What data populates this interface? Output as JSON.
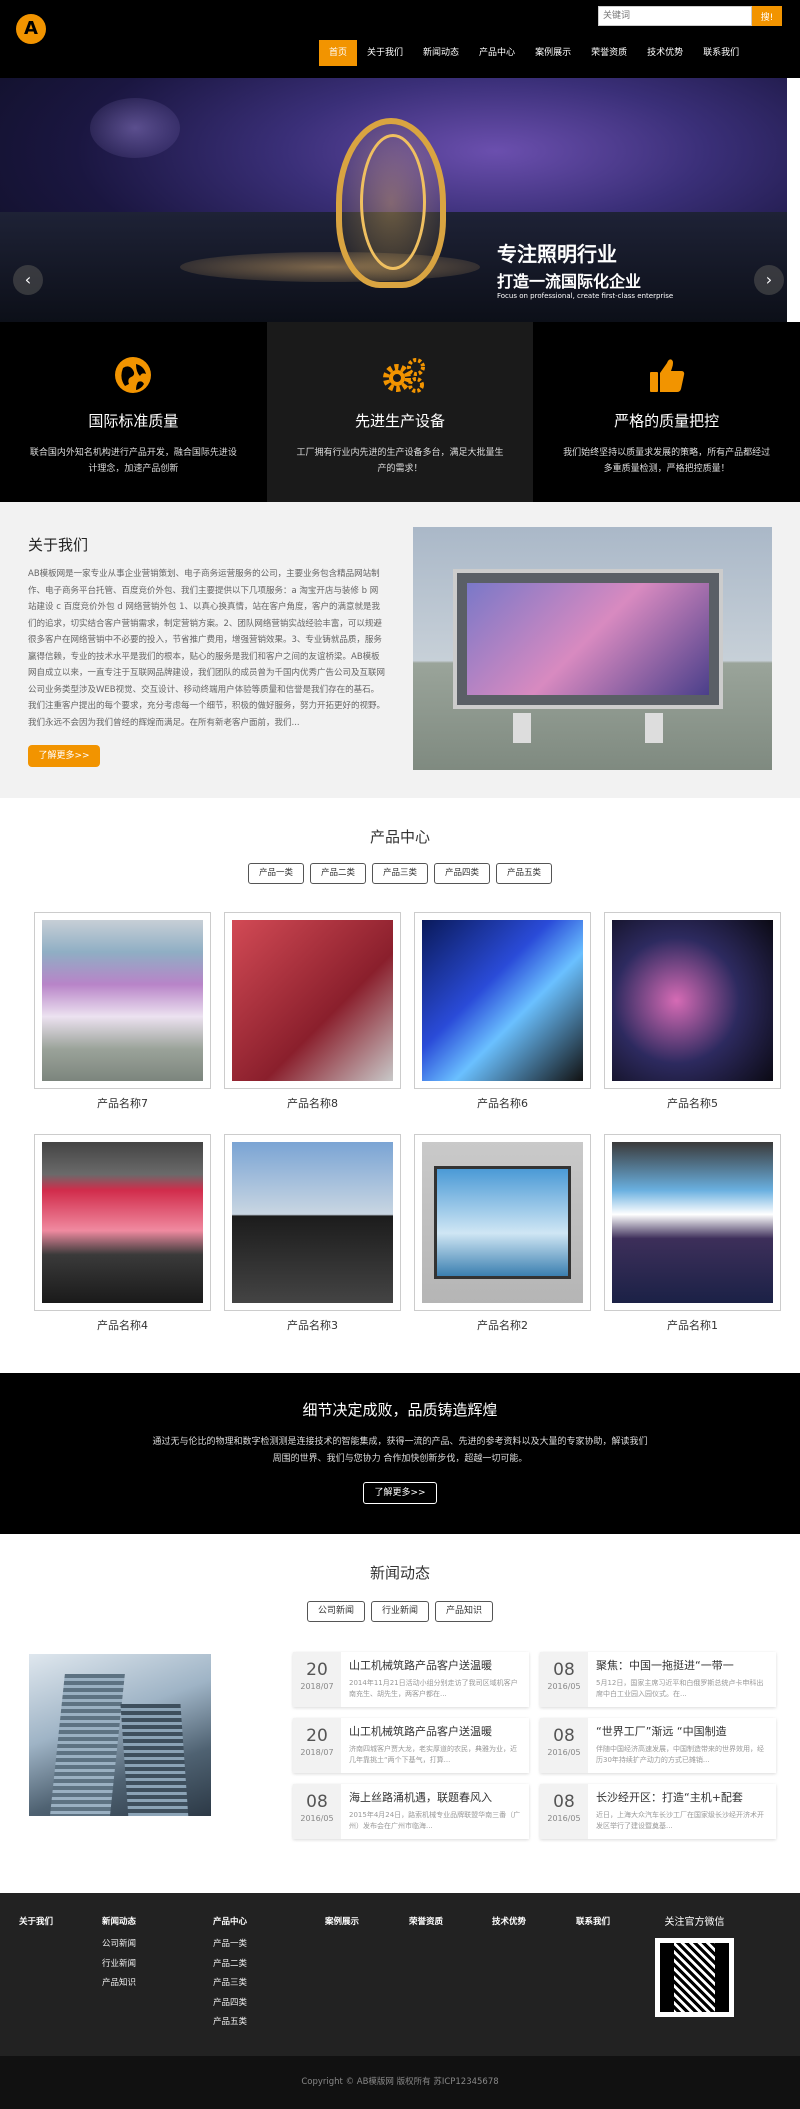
{
  "header": {
    "logo_text": "A",
    "search_placeholder": "关键词",
    "search_button": "搜!",
    "nav": [
      "首页",
      "关于我们",
      "新闻动态",
      "产品中心",
      "案例展示",
      "荣誉资质",
      "技术优势",
      "联系我们"
    ],
    "active_nav": "首页"
  },
  "banner": {
    "slogan_main": "专注照明行业",
    "slogan_sub": "打造一流国际化企业",
    "slogan_en": "Focus on professional, create first-class enterprise",
    "prev_icon": "chevron-left-icon",
    "next_icon": "chevron-right-icon"
  },
  "features": [
    {
      "icon": "globe-icon",
      "title": "国际标准质量",
      "desc": "联合国内外知名机构进行产品开发，融合国际先进设计理念，加速产品创新"
    },
    {
      "icon": "gears-icon",
      "title": "先进生产设备",
      "desc": "工厂拥有行业内先进的生产设备多台，满足大批量生产的需求！"
    },
    {
      "icon": "thumbs-up-icon",
      "title": "严格的质量把控",
      "desc": "我们始终坚持以质量求发展的策略，所有产品都经过多重质量检测，严格把控质量！"
    }
  ],
  "about": {
    "title": "关于我们",
    "text": "AB模板网是一家专业从事企业营销策划、电子商务运营服务的公司，主要业务包含精品网站制作、电子商务平台托管、百度竞价外包、我们主要提供以下几项服务：a 淘宝开店与装修 b 网站建设 c 百度竞价外包 d 网络营销外包 1、以真心换真情，站在客户角度，客户的满意就是我们的追求，切实结合客户营销需求，制定营销方案。2、团队网络营销实战经验丰富，可以规避很多客户在网络营销中不必要的投入，节省推广费用，增强营销效果。3、专业铸就品质，服务赢得信赖，专业的技术水平是我们的根本，贴心的服务是我们和客户之间的友谊桥梁。AB模板网自成立以来，一直专注于互联网品牌建设，我们团队的成员曾为千国内优秀广告公司及互联网公司业务类型涉及WEB视觉、交互设计、移动终端用户体验等质量和信誉是我们存在的基石。我们注重客户提出的每个要求，充分考虑每一个细节，积极的做好服务，努力开拓更好的视野。我们永远不会因为我们曾经的辉煌而满足。在所有新老客户面前，我们...",
    "more_button": "了解更多>>"
  },
  "products": {
    "title": "产品中心",
    "tabs": [
      "产品一类",
      "产品二类",
      "产品三类",
      "产品四类",
      "产品五类"
    ],
    "items": [
      {
        "name": "产品名称7",
        "img": "img7"
      },
      {
        "name": "产品名称8",
        "img": "img2"
      },
      {
        "name": "产品名称6",
        "img": "img3"
      },
      {
        "name": "产品名称5",
        "img": "img4"
      },
      {
        "name": "产品名称4",
        "img": "img5"
      },
      {
        "name": "产品名称3",
        "img": "img6"
      },
      {
        "name": "产品名称2",
        "img": "img1"
      },
      {
        "name": "产品名称1",
        "img": "img8"
      }
    ]
  },
  "detail": {
    "title": "细节决定成败，品质铸造辉煌",
    "text": "通过无与伦比的物理和数字检测测是连接技术的智能集成，获得一流的产品、先进的参考资料以及大量的专家协助，解读我们周围的世界、我们与您协力 合作加快创新步伐，超越一切可能。",
    "button": "了解更多>>"
  },
  "news": {
    "title": "新闻动态",
    "tabs": [
      "公司新闻",
      "行业新闻",
      "产品知识"
    ],
    "items": [
      {
        "day": "20",
        "ym": "2018/07",
        "title": "山工机械筑路产品客户送温暖",
        "summary": "2014年11月21日活动小组分别走访了我司区域机客户南充生、胡先生，两客户都在..."
      },
      {
        "day": "08",
        "ym": "2016/05",
        "title": "聚焦：中国一拖挺进“一带一",
        "summary": "5月12日，国家主席习近平和白俄罗斯总统卢卡申科出席中白工业园入园仪式。在..."
      },
      {
        "day": "20",
        "ym": "2018/07",
        "title": "山工机械筑路产品客户送温暖",
        "summary": "济南四城客户贾大龙，老实厚道的农民，典雅为业，近几年靠挑土“两个下基气，打算..."
      },
      {
        "day": "08",
        "ym": "2016/05",
        "title": "“世界工厂”渐远 “中国制造",
        "summary": "伴随中国经济高速发展，中国制造带来的世界效用，经历30年持续扩产动力的方式已摊销..."
      },
      {
        "day": "08",
        "ym": "2016/05",
        "title": "海上丝路涌机遇，联题春风入",
        "summary": "2015年4月24日，路索机械专业品牌联盟华南三番（广州）发布会在广州市临海..."
      },
      {
        "day": "08",
        "ym": "2016/05",
        "title": "长沙经开区：打造“主机+配套",
        "summary": "近日，上海大众汽车长沙工厂在国家级长沙经开济术开发区举行了建设暨奠基..."
      }
    ]
  },
  "footer": {
    "cols": [
      {
        "head": "关于我们",
        "links": []
      },
      {
        "head": "新闻动态",
        "links": [
          "公司新闻",
          "行业新闻",
          "产品知识"
        ]
      },
      {
        "head": "产品中心",
        "links": [
          "产品一类",
          "产品二类",
          "产品三类",
          "产品四类",
          "产品五类"
        ]
      },
      {
        "head": "案例展示",
        "links": []
      },
      {
        "head": "荣誉资质",
        "links": []
      },
      {
        "head": "技术优势",
        "links": []
      },
      {
        "head": "联系我们",
        "links": []
      }
    ],
    "wechat_title": "关注官方微信",
    "copyright": "Copyright © AB模版网 版权所有   苏ICP12345678"
  },
  "colors": {
    "accent": "#f29400",
    "dark": "#000000",
    "footer": "#222222"
  }
}
